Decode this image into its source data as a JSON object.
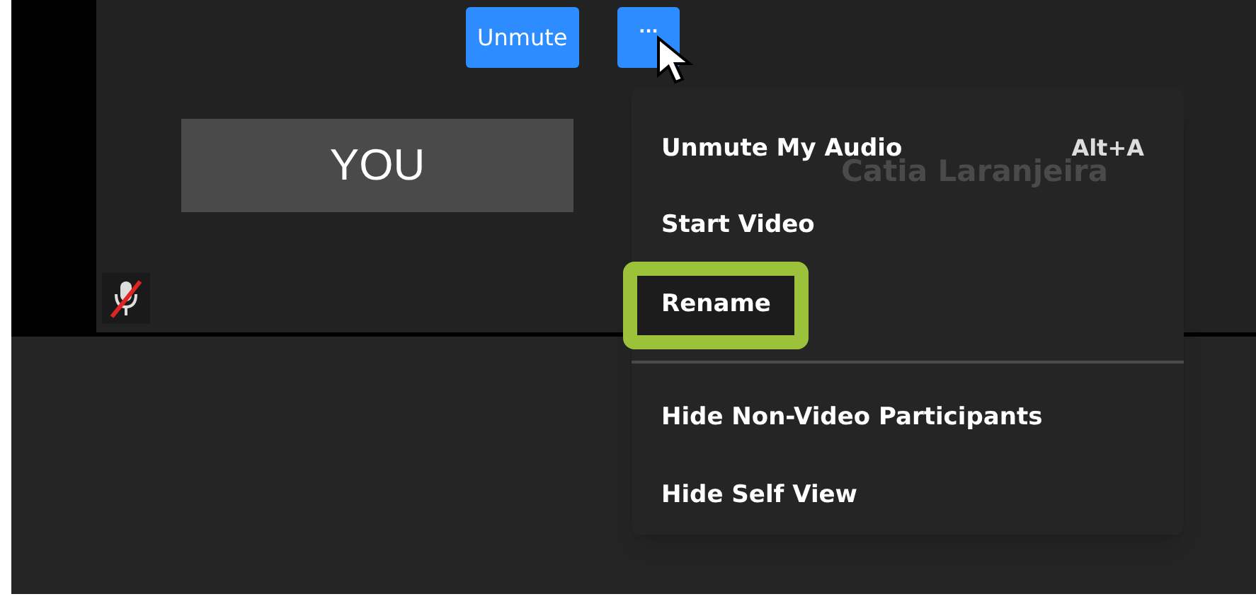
{
  "self_tile": {
    "name_label": "YOU",
    "muted": true,
    "participant_name": "Catia Laranjeira"
  },
  "toolbar": {
    "unmute_button": "Unmute",
    "more_button": "···"
  },
  "menu": {
    "items": [
      {
        "label": "Unmute My Audio",
        "shortcut": "Alt+A",
        "highlighted": false,
        "separator_before": false
      },
      {
        "label": "Start Video",
        "highlighted": false,
        "separator_before": false
      },
      {
        "label": "Rename",
        "highlighted": true,
        "separator_before": false
      },
      {
        "label": "Hide Non-Video Participants",
        "highlighted": false,
        "separator_before": true
      },
      {
        "label": "Hide Self View",
        "highlighted": false,
        "separator_before": false
      }
    ]
  }
}
